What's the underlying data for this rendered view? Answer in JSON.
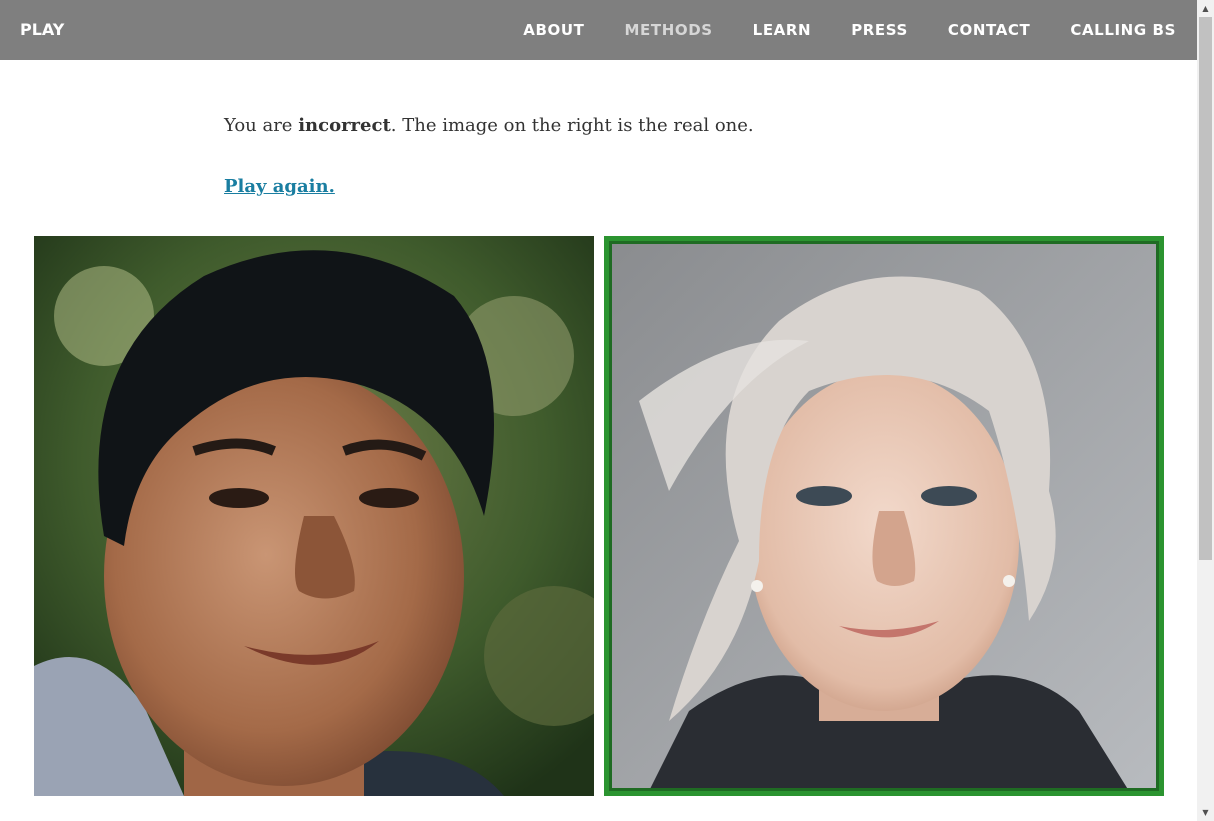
{
  "nav": {
    "brand": "PLAY",
    "items": [
      {
        "label": "ABOUT",
        "active": false
      },
      {
        "label": "METHODS",
        "active": true
      },
      {
        "label": "LEARN",
        "active": false
      },
      {
        "label": "PRESS",
        "active": false
      },
      {
        "label": "CONTACT",
        "active": false
      },
      {
        "label": "CALLING BS",
        "active": false
      }
    ]
  },
  "result": {
    "prefix": "You are ",
    "verdict": "incorrect",
    "suffix": ". The image on the right is the real one.",
    "play_again": "Play again."
  },
  "images": {
    "left": {
      "icon": "person-photo-icon",
      "is_real": false
    },
    "right": {
      "icon": "person-photo-icon",
      "is_real": true
    }
  },
  "colors": {
    "nav_bg": "#7f7f7f",
    "link": "#1a7ea1",
    "correct_border": "#2b9430"
  }
}
